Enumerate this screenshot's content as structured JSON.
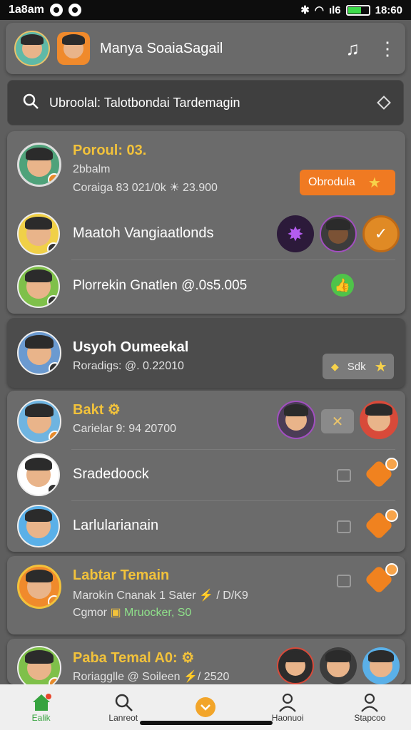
{
  "status": {
    "time_left": "1a8am",
    "time_right": "18:60",
    "signal": "ıl6"
  },
  "header": {
    "title": "Manya SoaiaSagail"
  },
  "search": {
    "query": "Ubroolal: Talotbondai Tardemagin"
  },
  "card1": {
    "rows": [
      {
        "name": "Poroul: 03.",
        "line2": "2bbalm",
        "line3": "Coraiga 83 021/0k ☀ 23.900",
        "action": "Obrodula"
      },
      {
        "name": "Maatoh Vangiaatlonds"
      },
      {
        "name": "Plorrekin Gnatlen @.0s5.005"
      }
    ]
  },
  "card2": {
    "name": "Usyoh Oumeekal",
    "line2": "Roradigs: @. 0.22010",
    "action": "Sdk"
  },
  "card3": {
    "rows": [
      {
        "name": "Bakt ⚙",
        "line2": "Carielar 9: 94 20700"
      },
      {
        "name": "Sradedoock"
      },
      {
        "name": "Larlularianain"
      }
    ]
  },
  "card4": {
    "name": "Labtar Temain",
    "line2": "Marokin Cnanak 1 Sater ⚡ / D/K9",
    "line3a": "Cgmor",
    "line3b": "Mruocker, S0"
  },
  "card5": {
    "name": "Paba Temal A0: ⚙",
    "line2": "Roriagglle @ Soileen ⚡/ 2520"
  },
  "nav": {
    "items": [
      "Ealik",
      "Lanreot",
      "",
      "Haonuoi",
      "Stapcoo"
    ]
  },
  "colors": {
    "accent": "#f07a22",
    "gold": "#f2c23b",
    "active": "#36a33f"
  }
}
